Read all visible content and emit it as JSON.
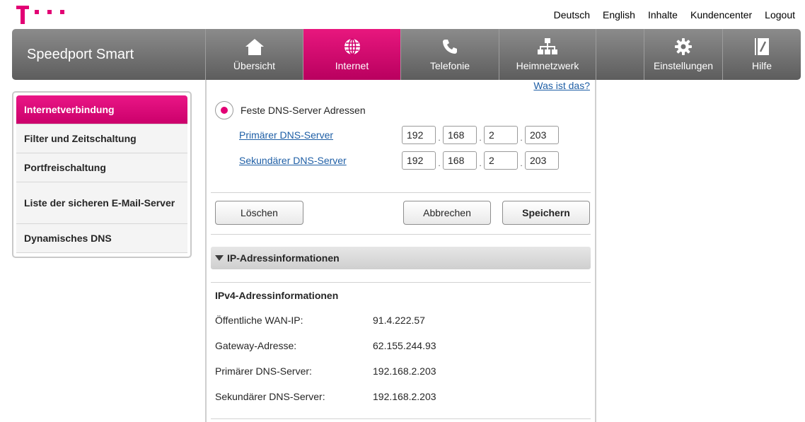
{
  "topnav": {
    "deutsch": "Deutsch",
    "english": "English",
    "inhalte": "Inhalte",
    "kundencenter": "Kundencenter",
    "logout": "Logout"
  },
  "brand": "Speedport Smart",
  "nav": {
    "uebersicht": "Übersicht",
    "internet": "Internet",
    "telefonie": "Telefonie",
    "heimnetzwerk": "Heimnetzwerk",
    "einstellungen": "Einstellungen",
    "hilfe": "Hilfe"
  },
  "sidebar": {
    "items": [
      "Internetverbindung",
      "Filter und Zeitschaltung",
      "Portfreischaltung",
      "Liste der sicheren E-Mail-Server",
      "Dynamisches DNS"
    ]
  },
  "content": {
    "help_link": "Was ist das?",
    "radio_label": "Feste DNS-Server Adressen",
    "primary_label": "Primärer DNS-Server",
    "secondary_label": "Sekundärer DNS-Server",
    "primary_ip": [
      "192",
      "168",
      "2",
      "203"
    ],
    "secondary_ip": [
      "192",
      "168",
      "2",
      "203"
    ],
    "btn_loeschen": "Löschen",
    "btn_abbrechen": "Abbrechen",
    "btn_speichern": "Speichern",
    "section_title": "IP-Adressinformationen",
    "ipv4_title": "IPv4-Adressinformationen",
    "info": [
      {
        "key": "Öffentliche WAN-IP:",
        "value": "91.4.222.57"
      },
      {
        "key": "Gateway-Adresse:",
        "value": "62.155.244.93"
      },
      {
        "key": "Primärer DNS-Server:",
        "value": "192.168.2.203"
      },
      {
        "key": "Sekundärer DNS-Server:",
        "value": "192.168.2.203"
      }
    ]
  },
  "colors": {
    "brand_magenta": "#e20074",
    "nav_gray": "#6f6f6f",
    "link_blue": "#1f5fa6"
  }
}
